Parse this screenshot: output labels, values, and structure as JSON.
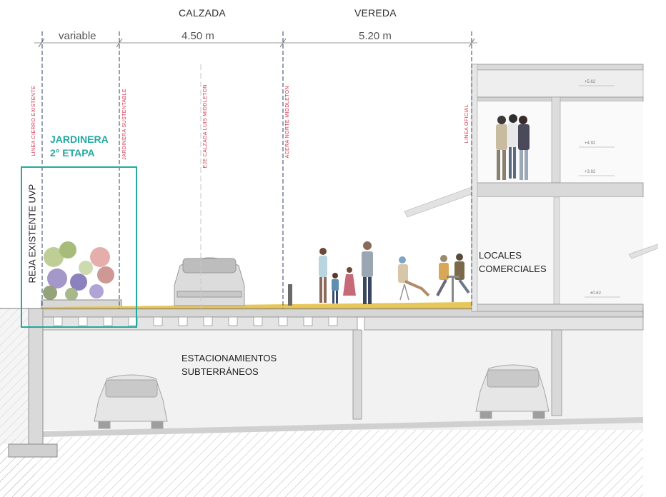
{
  "headers": {
    "calzada": "CALZADA",
    "vereda": "VEREDA"
  },
  "dimensions": {
    "variable": "variable",
    "calzada_width": "4.50 m",
    "vereda_width": "5.20 m"
  },
  "vertical_labels": {
    "linea_cierro": "LINEA CIERRO EXISTENTE",
    "jardinera_sustentable": "JARDINERA SUSTENTABLE",
    "eje_calzada": "EJE CALZADA LUIS MIDDLETON",
    "acera_norte": "ACERA NORTE MIDDLETON",
    "linea_oficial": "LINEA OFICIAL"
  },
  "jardinera": {
    "line1": "JARDINERA",
    "line2": "2° ETAPA"
  },
  "reja": "REJA EXISTENTE UVP",
  "locales": {
    "line1": "LOCALES",
    "line2": "COMERCIALES"
  },
  "parking": {
    "line1": "ESTACIONAMIENTOS",
    "line2": "SUBTERRÁNEOS"
  },
  "levels": {
    "l1": "+5.62",
    "l2": "+4.92",
    "l3": "+3.92",
    "l4": "±0.62"
  },
  "colors": {
    "accent_teal": "#22a9a0",
    "axis_red": "#d0304a",
    "sidewalk_yellow": "#e8c75a",
    "structure_gray": "#d9d9d9"
  }
}
